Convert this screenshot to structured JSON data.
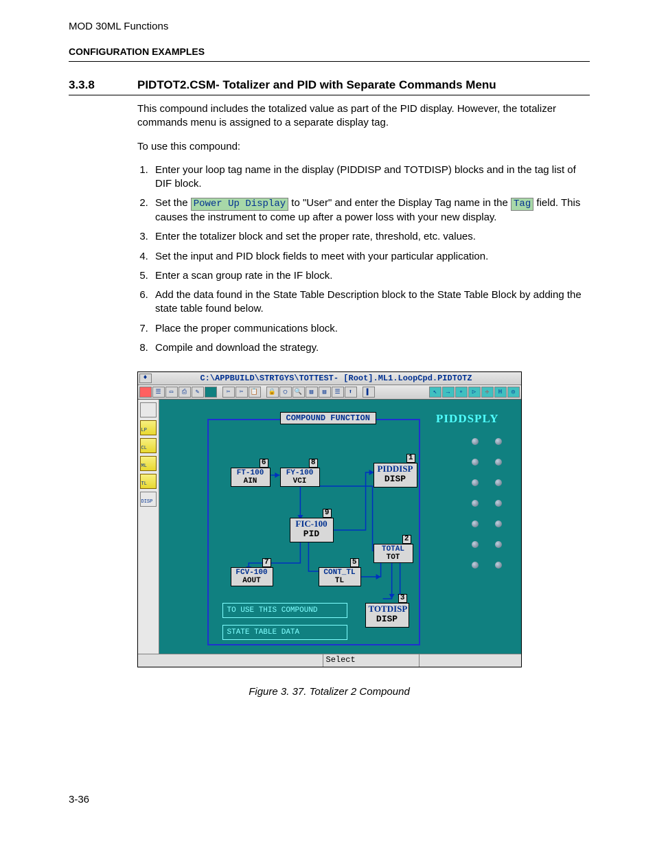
{
  "running_head": "MOD 30ML Functions",
  "section_label": "CONFIGURATION EXAMPLES",
  "heading": {
    "number": "3.3.8",
    "title": "PIDTOT2.CSM- Totalizer and PID with Separate Commands Menu"
  },
  "intro": "This compound includes the totalized value as part of the PID display. However, the totalizer commands menu is assigned to a separate display tag.",
  "lead": "To use this compound:",
  "chip_powerup": "Power Up Display",
  "chip_tag": "Tag",
  "steps": {
    "s1": "Enter your loop tag name in the display (PIDDISP and TOTDISP) blocks and in the tag list of DIF block.",
    "s2a": "Set the ",
    "s2b": " to \"User\" and enter the Display Tag name in the ",
    "s2c": " field. This causes the instrument to come up after a power loss with your new display.",
    "s3": "Enter the totalizer block and set the proper rate, threshold, etc. values.",
    "s4": "Set the input and PID block fields to meet with your particular application.",
    "s5": "Enter a scan group rate in the IF block.",
    "s6": "Add the data found in the State Table Description block to the State Table Block by adding the state table found below.",
    "s7": "Place the proper communications block.",
    "s8": "Compile and download the strategy."
  },
  "shot": {
    "title_ctl": "♦",
    "title": "C:\\APPBUILD\\STRTGYS\\TOTTEST- [Root].ML1.LoopCpd.PIDTOTZ",
    "grp_title": "COMPOUND FUNCTION",
    "side_title": "PIDDSPLY",
    "palette": [
      "LP",
      "CL",
      "ML",
      "TL",
      "DISP"
    ],
    "blocks": {
      "ft": {
        "name": "FT-100",
        "sub": "AIN",
        "corner": "6"
      },
      "fy": {
        "name": "FY-100",
        "sub": "VCI",
        "corner": "8"
      },
      "pid": {
        "name": "FIC-100",
        "sub": "PID",
        "corner": "9"
      },
      "fcv": {
        "name": "FCV-100",
        "sub": "AOUT",
        "corner": "7"
      },
      "ctl": {
        "name": "CONT_TL",
        "sub": "TL",
        "corner": "5"
      },
      "tot": {
        "name": "TOTAL",
        "sub": "TOT",
        "corner": "2"
      },
      "pd": {
        "name": "PIDDISP",
        "sub": "DISP",
        "corner": "1"
      },
      "td": {
        "name": "TOTDISP",
        "sub": "DISP",
        "corner": "3"
      }
    },
    "notes": {
      "use": "TO USE THIS COMPOUND",
      "state": "STATE TABLE DATA"
    },
    "status": "Select"
  },
  "caption": "Figure 3. 37. Totalizer 2 Compound",
  "page_no": "3-36"
}
